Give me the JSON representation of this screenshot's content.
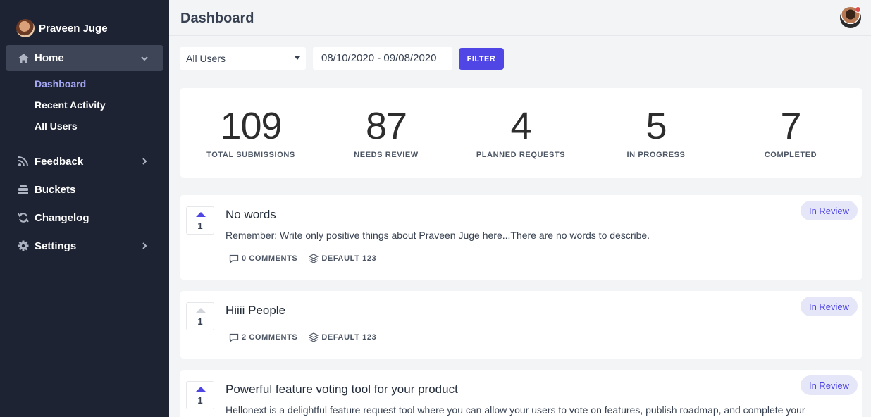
{
  "user": {
    "name": "Praveen Juge"
  },
  "sidebar": {
    "home": {
      "label": "Home",
      "icon": "home-icon"
    },
    "sub_items": [
      {
        "label": "Dashboard",
        "active": true
      },
      {
        "label": "Recent Activity",
        "active": false
      },
      {
        "label": "All Users",
        "active": false
      }
    ],
    "items": [
      {
        "label": "Feedback",
        "icon": "rss-icon",
        "has_chevron": true
      },
      {
        "label": "Buckets",
        "icon": "buckets-icon",
        "has_chevron": false
      },
      {
        "label": "Changelog",
        "icon": "refresh-icon",
        "has_chevron": false
      },
      {
        "label": "Settings",
        "icon": "gear-icon",
        "has_chevron": true
      }
    ]
  },
  "header": {
    "title": "Dashboard"
  },
  "filters": {
    "user_select": "All Users",
    "date_range": "08/10/2020 - 09/08/2020",
    "filter_label": "FILTER"
  },
  "stats": [
    {
      "value": "109",
      "label": "TOTAL SUBMISSIONS"
    },
    {
      "value": "87",
      "label": "NEEDS REVIEW"
    },
    {
      "value": "4",
      "label": "PLANNED REQUESTS"
    },
    {
      "value": "5",
      "label": "IN PROGRESS"
    },
    {
      "value": "7",
      "label": "COMPLETED"
    }
  ],
  "posts": [
    {
      "votes": "1",
      "voted": true,
      "title": "No words",
      "description": "Remember: Write only positive things about Praveen Juge here...There are no words to describe.",
      "comments": "0 COMMENTS",
      "bucket": "DEFAULT 123",
      "status": "In Review"
    },
    {
      "votes": "1",
      "voted": false,
      "title": "Hiiii People",
      "description": "",
      "comments": "2 COMMENTS",
      "bucket": "DEFAULT 123",
      "status": "In Review"
    },
    {
      "votes": "1",
      "voted": true,
      "title": "Powerful feature voting tool for your product",
      "description": "Hellonext is a delightful feature request tool where you can allow your users to vote on features, publish roadmap, and complete your",
      "status": "In Review"
    }
  ],
  "colors": {
    "sidebar_bg": "#1e2333",
    "accent": "#4f46e5",
    "active_nav": "#3d4556"
  }
}
